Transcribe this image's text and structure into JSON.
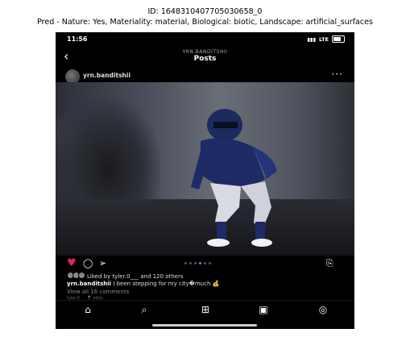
{
  "caption": {
    "id_line": "ID: 1648310407705030658_0",
    "pred_line": "Pred - Nature: Yes, Materiality: material, Biological: biotic, Landscape: artificial_surfaces"
  },
  "status_bar": {
    "time": "11:56",
    "carrier": "LTE"
  },
  "header": {
    "subtitle": "YRN.BANDITSHII",
    "title": "Posts",
    "back_icon": "chevron-left-icon"
  },
  "post": {
    "username": "yrn.banditshii",
    "more_icon": "more-horizontal-icon",
    "photo_alt": "football-player-photo",
    "likes_text": "Liked by tyler.0___ and 120 others",
    "caption_user": "yrn.banditshii",
    "caption_text": " I been stepping for my city�much 💰",
    "comments_link": "View all 16 comments",
    "extra_line": "tyler.0___ 📍 ebbs"
  },
  "colors": {
    "like_red": "#e0245e",
    "active_dot": "#3897f0"
  },
  "nav": {
    "icons": [
      "home-icon",
      "search-icon",
      "add-post-icon",
      "reels-icon",
      "profile-icon"
    ]
  }
}
